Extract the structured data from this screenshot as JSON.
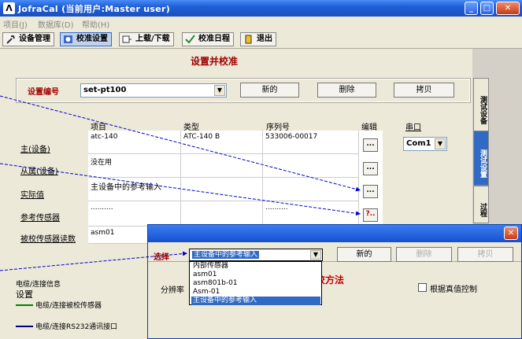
{
  "window": {
    "title": "JofraCal (当前用户:Master user)",
    "icon_letter": "Λ"
  },
  "menu": [
    "项目(J)",
    "数据库(D)",
    "帮助(H)"
  ],
  "toolbar": [
    {
      "label": "设备管理"
    },
    {
      "label": "校准设置"
    },
    {
      "label": "上载/下载"
    },
    {
      "label": "校准日程"
    },
    {
      "label": "退出"
    }
  ],
  "page_heading": "设置并校准",
  "setup": {
    "label": "设置编号",
    "value": "set-pt100",
    "new_btn": "新的",
    "delete_btn": "删除",
    "copy_btn": "拷贝"
  },
  "columns": {
    "item": "项目",
    "type": "类型",
    "serial": "序列号",
    "edit": "编辑",
    "port": "串口"
  },
  "rows": [
    {
      "label": "主(设备)",
      "item": "atc-140",
      "type": "ATC-140 B",
      "serial": "533006-00017",
      "edit": "...",
      "port": "Com1"
    },
    {
      "label": "从属(设备)",
      "item": "没在用",
      "type": "",
      "serial": "",
      "edit": "..."
    },
    {
      "label": "实际值",
      "item": "主设备中的参考输入",
      "type": "",
      "serial": "",
      "edit": "..."
    },
    {
      "label": "参考传感器",
      "item": "..........",
      "type": "",
      "serial": "..........",
      "edit": "?.."
    },
    {
      "label": "被校传感器读数",
      "item": "asm01",
      "type": "",
      "serial": ""
    }
  ],
  "side_tabs": [
    "测试设备",
    "测试设置",
    "过程"
  ],
  "legend": {
    "title": "电缆/连接信息",
    "subtitle": "设置",
    "items": [
      {
        "label": "电缆/连接被校传感器",
        "color": "#008000"
      },
      {
        "label": "电缆/连接RS232通讯接口",
        "color": "#000080"
      }
    ]
  },
  "dialog": {
    "select_label": "选择",
    "select_value": "主设备中的参考输入",
    "new_btn": "新的",
    "delete_btn": "删除",
    "copy_btn": "拷贝",
    "options": [
      "内部传感器",
      "asm01",
      "asm801b-01",
      "Asm-01",
      "主设备中的参考输入"
    ],
    "resolution_label": "分辨率",
    "method_partial": "校方法",
    "control_checkbox": "根据真值控制"
  },
  "colors": {
    "accent_red": "#a00000",
    "title_blue": "#1f5fd6",
    "arrow_blue": "#0000cc"
  }
}
